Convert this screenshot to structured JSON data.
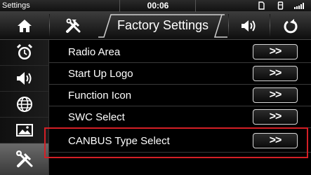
{
  "status_bar": {
    "title": "Settings",
    "time": "00:06",
    "icons": [
      "document-icon",
      "usb-icon",
      "signal-icon"
    ]
  },
  "top_bar": {
    "title": "Factory Settings",
    "icons": [
      "home-icon",
      "tools-icon",
      "volume-icon",
      "power-icon"
    ]
  },
  "sidebar": {
    "items": [
      {
        "icon": "alarm-clock-icon",
        "active": false
      },
      {
        "icon": "speaker-icon",
        "active": false
      },
      {
        "icon": "globe-icon",
        "active": false
      },
      {
        "icon": "picture-icon",
        "active": false
      },
      {
        "icon": "tools-icon",
        "active": true
      }
    ]
  },
  "settings": {
    "rows": [
      {
        "label": "Radio Area",
        "button": ">>"
      },
      {
        "label": "Start Up Logo",
        "button": ">>"
      },
      {
        "label": "Function Icon",
        "button": ">>"
      },
      {
        "label": "SWC Select",
        "button": ">>"
      },
      {
        "label": "CANBUS Type Select",
        "button": ">>"
      }
    ]
  },
  "colors": {
    "highlight": "#d41f26",
    "background": "#000000",
    "text": "#ffffff"
  }
}
